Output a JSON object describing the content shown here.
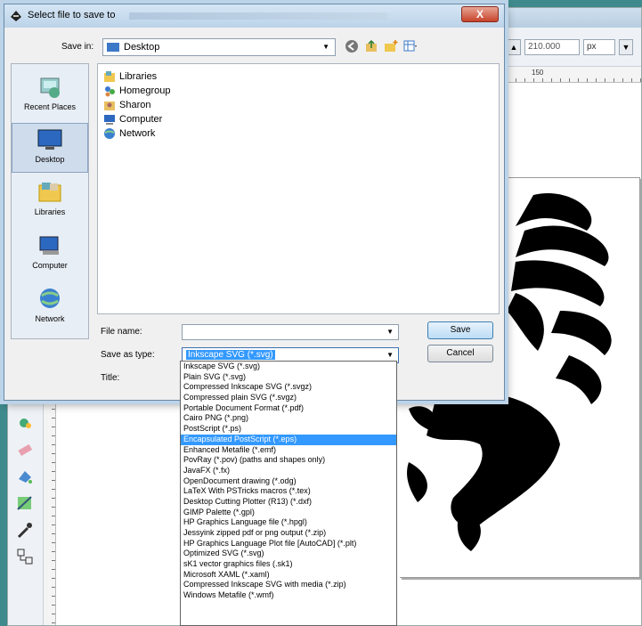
{
  "dialog": {
    "title": "Select file to save to",
    "close_label": "X",
    "save_in_label": "Save in:",
    "save_in_value": "Desktop",
    "places": [
      "Recent Places",
      "Desktop",
      "Libraries",
      "Computer",
      "Network"
    ],
    "files": [
      "Libraries",
      "Homegroup",
      "Sharon",
      "Computer",
      "Network"
    ],
    "file_name_label": "File name:",
    "file_name_value": "",
    "save_as_type_label": "Save as type:",
    "save_as_type_value": "Inkscape SVG (*.svg)",
    "title_label": "Title:",
    "save_button": "Save",
    "cancel_button": "Cancel"
  },
  "file_types": [
    "Inkscape SVG (*.svg)",
    "Plain SVG (*.svg)",
    "Compressed Inkscape SVG (*.svgz)",
    "Compressed plain SVG (*.svgz)",
    "Portable Document Format (*.pdf)",
    "Cairo PNG (*.png)",
    "PostScript (*.ps)",
    "Encapsulated PostScript (*.eps)",
    "Enhanced Metafile (*.emf)",
    "PovRay (*.pov) (paths and shapes only)",
    "JavaFX (*.fx)",
    "OpenDocument drawing (*.odg)",
    "LaTeX With PSTricks macros (*.tex)",
    "Desktop Cutting Plotter (R13) (*.dxf)",
    "GIMP Palette (*.gpl)",
    "HP Graphics Language file (*.hpgl)",
    "Jessyink zipped pdf or png output (*.zip)",
    "HP Graphics Language Plot file [AutoCAD] (*.plt)",
    "Optimized SVG (*.svg)",
    "sK1 vector graphics files (.sk1)",
    "Microsoft XAML (*.xaml)",
    "Compressed Inkscape SVG with media (*.zip)",
    "Windows Metafile (*.wmf)"
  ],
  "selected_file_type_index": 7,
  "app": {
    "width_value": "210.000",
    "unit_value": "px",
    "ruler_label": "150"
  },
  "colors": {
    "selection": "#3399ff",
    "desktop_bg": "#3f8a8c"
  }
}
